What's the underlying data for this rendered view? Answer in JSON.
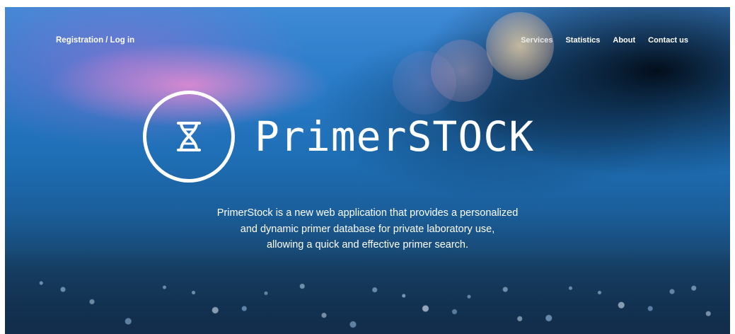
{
  "nav": {
    "login_label": "Registration / Log in",
    "items": [
      {
        "label": "Services",
        "active": true
      },
      {
        "label": "Statistics",
        "active": false
      },
      {
        "label": "About",
        "active": false
      },
      {
        "label": "Contact us",
        "active": false
      }
    ]
  },
  "hero": {
    "logo_icon": "dna-helix-icon",
    "title": "PrimerSTOCK",
    "description_lines": [
      "PrimerStock is a new web application that provides a personalized",
      "and dynamic primer database for private laboratory use,",
      "allowing a quick and effective primer search."
    ]
  },
  "colors": {
    "text": "#ffffff",
    "sky_blue": "#2a7cc9",
    "dark_blue": "#0f2a45",
    "pink_glow": "#eb8cd2"
  }
}
